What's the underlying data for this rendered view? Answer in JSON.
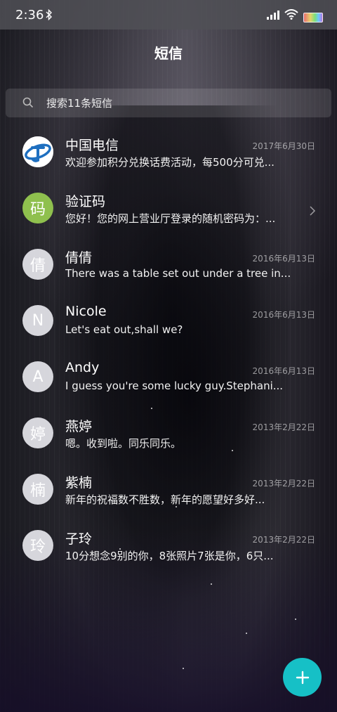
{
  "status_bar": {
    "time": "2:36",
    "icons": [
      "bluetooth-icon",
      "signal-icon",
      "wifi-icon",
      "battery-icon"
    ]
  },
  "header": {
    "title": "短信"
  },
  "search": {
    "placeholder": "搜索11条短信"
  },
  "conversations": [
    {
      "name": "中国电信",
      "date": "2017年6月30日",
      "preview": "欢迎参加积分兑换话费活动，每500分可兑...",
      "avatar": "",
      "avatar_style": "telecom"
    },
    {
      "name": "验证码",
      "date": "",
      "preview": "您好！您的网上营业厅登录的随机密码为：...",
      "avatar": "码",
      "avatar_style": "green"
    },
    {
      "name": "倩倩",
      "date": "2016年6月13日",
      "preview": "There was a table set out under a tree in...",
      "avatar": "倩",
      "avatar_style": "grey"
    },
    {
      "name": "Nicole",
      "date": "2016年6月13日",
      "preview": "Let's eat out,shall we?",
      "avatar": "N",
      "avatar_style": "grey"
    },
    {
      "name": "Andy",
      "date": "2016年6月13日",
      "preview": "I guess you're some lucky guy.Stephani...",
      "avatar": "A",
      "avatar_style": "grey"
    },
    {
      "name": "燕婷",
      "date": "2013年2月22日",
      "preview": "嗯。收到啦。同乐同乐。",
      "avatar": "婷",
      "avatar_style": "grey"
    },
    {
      "name": "紫楠",
      "date": "2013年2月22日",
      "preview": "新年的祝福数不胜数，新年的愿望好多好...",
      "avatar": "楠",
      "avatar_style": "grey"
    },
    {
      "name": "子玲",
      "date": "2013年2月22日",
      "preview": "10分想念9别的你，8张照片7张是你，6只...",
      "avatar": "玲",
      "avatar_style": "grey"
    }
  ],
  "fab": {
    "icon": "plus-icon"
  },
  "colors": {
    "fab": "#16c0c6",
    "avatar_green": "#8fc04e"
  }
}
